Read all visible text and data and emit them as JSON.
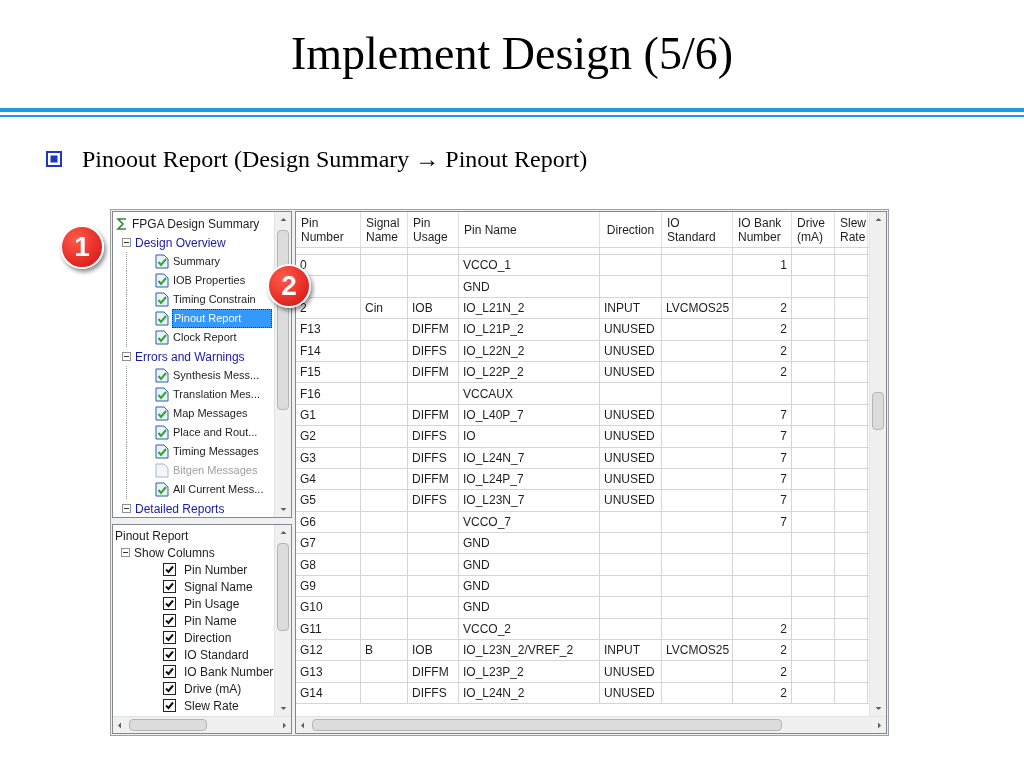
{
  "slide": {
    "title": "Implement Design (5/6)",
    "bullet": "Pinoout Report (Design Summary → Pinout Report)"
  },
  "callouts": [
    {
      "text": "1"
    },
    {
      "text": "2"
    }
  ],
  "summary_tree": {
    "root": "FPGA Design Summary",
    "groups": [
      {
        "label": "Design Overview",
        "expanded": true,
        "children": [
          {
            "label": "Summary",
            "checked": true,
            "selected": false
          },
          {
            "label": "IOB Properties",
            "checked": true,
            "selected": false
          },
          {
            "label": "Timing Constrain",
            "checked": true,
            "selected": false
          },
          {
            "label": "Pinout Report",
            "checked": true,
            "selected": true
          },
          {
            "label": "Clock Report",
            "checked": true,
            "selected": false
          }
        ]
      },
      {
        "label": "Errors and Warnings",
        "expanded": true,
        "children": [
          {
            "label": "Synthesis Mess...",
            "checked": true,
            "selected": false
          },
          {
            "label": "Translation Mes...",
            "checked": true,
            "selected": false
          },
          {
            "label": "Map Messages",
            "checked": true,
            "selected": false
          },
          {
            "label": "Place and Rout...",
            "checked": true,
            "selected": false
          },
          {
            "label": "Timing Messages",
            "checked": true,
            "selected": false
          },
          {
            "label": "Bitgen Messages",
            "checked": false,
            "selected": false
          },
          {
            "label": "All Current Mess...",
            "checked": true,
            "selected": false
          }
        ]
      },
      {
        "label": "Detailed Reports",
        "expanded": true
      }
    ]
  },
  "column_options": {
    "title": "Pinout Report",
    "group": {
      "label": "Show Columns",
      "expanded": true,
      "children": [
        {
          "label": "Pin Number",
          "checked": true
        },
        {
          "label": "Signal Name",
          "checked": true
        },
        {
          "label": "Pin Usage",
          "checked": true
        },
        {
          "label": "Pin Name",
          "checked": true
        },
        {
          "label": "Direction",
          "checked": true
        },
        {
          "label": "IO Standard",
          "checked": true
        },
        {
          "label": "IO Bank Number",
          "checked": true
        },
        {
          "label": "Drive (mA)",
          "checked": true
        },
        {
          "label": "Slew Rate",
          "checked": true
        }
      ]
    }
  },
  "table": {
    "columns": [
      {
        "label": "Pin Number",
        "kind": "text"
      },
      {
        "label": "Signal Name",
        "kind": "text"
      },
      {
        "label": "Pin Usage",
        "kind": "text"
      },
      {
        "label": "Pin Name",
        "kind": "text"
      },
      {
        "label": "Direction",
        "kind": "text"
      },
      {
        "label": "IO Standard",
        "kind": "text"
      },
      {
        "label": "IO Bank Number",
        "kind": "number"
      },
      {
        "label": "Drive (mA)",
        "kind": "text"
      },
      {
        "label": "Slew Rate",
        "kind": "text"
      }
    ],
    "rows": [
      [
        "0",
        "",
        "",
        "VCCO_1",
        "",
        "",
        "1",
        "",
        ""
      ],
      [
        "",
        "",
        "",
        "GND",
        "",
        "",
        "",
        "",
        ""
      ],
      [
        "2",
        "Cin",
        "IOB",
        "IO_L21N_2",
        "INPUT",
        "LVCMOS25",
        "2",
        "",
        ""
      ],
      [
        "F13",
        "",
        "DIFFM",
        "IO_L21P_2",
        "UNUSED",
        "",
        "2",
        "",
        ""
      ],
      [
        "F14",
        "",
        "DIFFS",
        "IO_L22N_2",
        "UNUSED",
        "",
        "2",
        "",
        ""
      ],
      [
        "F15",
        "",
        "DIFFM",
        "IO_L22P_2",
        "UNUSED",
        "",
        "2",
        "",
        ""
      ],
      [
        "F16",
        "",
        "",
        "VCCAUX",
        "",
        "",
        "",
        "",
        ""
      ],
      [
        "G1",
        "",
        "DIFFM",
        "IO_L40P_7",
        "UNUSED",
        "",
        "7",
        "",
        ""
      ],
      [
        "G2",
        "",
        "DIFFS",
        "IO",
        "UNUSED",
        "",
        "7",
        "",
        ""
      ],
      [
        "G3",
        "",
        "DIFFS",
        "IO_L24N_7",
        "UNUSED",
        "",
        "7",
        "",
        ""
      ],
      [
        "G4",
        "",
        "DIFFM",
        "IO_L24P_7",
        "UNUSED",
        "",
        "7",
        "",
        ""
      ],
      [
        "G5",
        "",
        "DIFFS",
        "IO_L23N_7",
        "UNUSED",
        "",
        "7",
        "",
        ""
      ],
      [
        "G6",
        "",
        "",
        "VCCO_7",
        "",
        "",
        "7",
        "",
        ""
      ],
      [
        "G7",
        "",
        "",
        "GND",
        "",
        "",
        "",
        "",
        ""
      ],
      [
        "G8",
        "",
        "",
        "GND",
        "",
        "",
        "",
        "",
        ""
      ],
      [
        "G9",
        "",
        "",
        "GND",
        "",
        "",
        "",
        "",
        ""
      ],
      [
        "G10",
        "",
        "",
        "GND",
        "",
        "",
        "",
        "",
        ""
      ],
      [
        "G11",
        "",
        "",
        "VCCO_2",
        "",
        "",
        "2",
        "",
        ""
      ],
      [
        "G12",
        "B",
        "IOB",
        "IO_L23N_2/VREF_2",
        "INPUT",
        "LVCMOS25",
        "2",
        "",
        ""
      ],
      [
        "G13",
        "",
        "DIFFM",
        "IO_L23P_2",
        "UNUSED",
        "",
        "2",
        "",
        ""
      ],
      [
        "G14",
        "",
        "DIFFS",
        "IO_L24N_2",
        "UNUSED",
        "",
        "2",
        "",
        ""
      ]
    ]
  }
}
